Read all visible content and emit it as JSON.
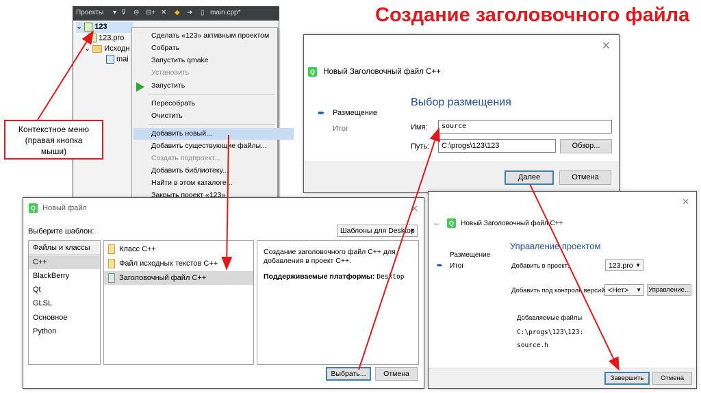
{
  "title": "Создание заголовочного файла",
  "qt_panel": {
    "projects_label": "Проекты",
    "editor_tab": "main.cpp*",
    "tree": {
      "project": "123",
      "pro_file": "123.pro",
      "sources": "Исходн",
      "main": "mai"
    }
  },
  "context_menu": {
    "items": [
      "Сделать «123» активным проектом",
      "Собрать",
      "Запустить qmake",
      "Установить",
      "Запустить",
      "Пересобрать",
      "Очистить",
      "Добавить новый...",
      "Добавить существующие файлы...",
      "Создать подпроект...",
      "Добавить библиотеку...",
      "Найти в этом каталоге...",
      "Закрыть проект «123»"
    ]
  },
  "callout": {
    "line1": "Контекстное меню",
    "line2": "(правая кнопка",
    "line3": "мыши)"
  },
  "new_file_dialog": {
    "title": "Новый файл",
    "choose_template": "Выберите шаблон:",
    "filter": "Шаблоны для Desktop",
    "categories_header": "Файлы и классы",
    "categories": [
      "C++",
      "BlackBerry",
      "Qt",
      "GLSL",
      "Основное",
      "Python"
    ],
    "templates": [
      "Класс C++",
      "Файл исходных текстов C++",
      "Заголовочный файл C++"
    ],
    "description": "Создание заголовочного файл C++ для добавления в проект C++.",
    "platforms_label": "Поддерживаемые платформы:",
    "platforms_value": "Desktop",
    "choose_button": "Выбрать...",
    "cancel_button": "Отмена"
  },
  "location_dialog": {
    "title": "Новый Заголовочный файл C++",
    "step_location": "Размещение",
    "step_summary": "Итог",
    "heading": "Выбор размещения",
    "name_label": "Имя:",
    "name_value": "source",
    "path_label": "Путь:",
    "path_value": "C:\\progs\\123\\123",
    "browse_button": "Обзор...",
    "next_button": "Далее",
    "cancel_button": "Отмена"
  },
  "project_dialog": {
    "title": "Новый Заголовочный файл C++",
    "step_location": "Размещение",
    "step_summary": "Итог",
    "heading": "Управление проектом",
    "add_to_project_label": "Добавить в проект:",
    "add_to_project_value": "123.pro",
    "vcs_label": "Добавить под контроль версий:",
    "vcs_value": "<Нет>",
    "manage_button": "Управление...",
    "files_label": "Добавляемые файлы",
    "file_dir": "C:\\progs\\123\\123:",
    "file_name": "source.h",
    "finish_button": "Завершить",
    "cancel_button": "Отмена"
  },
  "colors": {
    "accent_red": "#e0191e",
    "highlight": "#c7dcf3",
    "qt_green": "#41cd52"
  }
}
